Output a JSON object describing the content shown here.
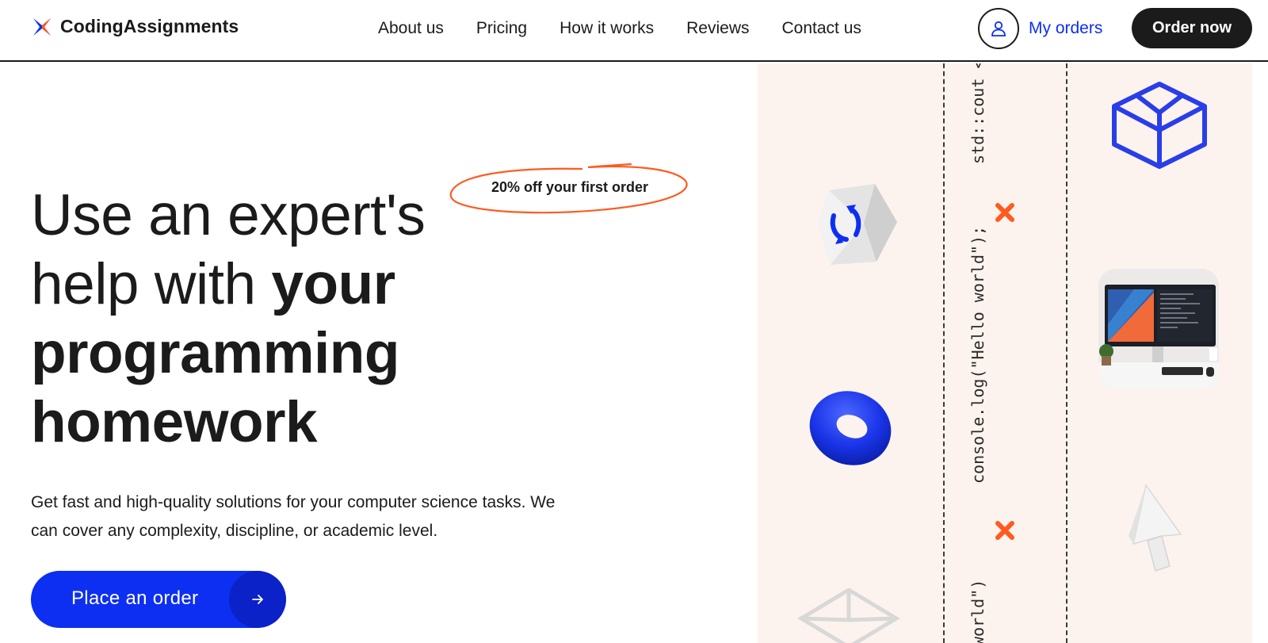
{
  "brand": {
    "name": "CodingAssignments",
    "mark_colors": [
      "#ff5a1f",
      "#0d2ff2"
    ]
  },
  "nav": {
    "items": [
      {
        "label": "About us"
      },
      {
        "label": "Pricing"
      },
      {
        "label": "How it works"
      },
      {
        "label": "Reviews"
      },
      {
        "label": "Contact us"
      }
    ]
  },
  "account": {
    "my_orders_label": "My orders",
    "icon": "user-icon"
  },
  "header_cta": {
    "label": "Order now"
  },
  "hero": {
    "title_line1": "Use an expert's",
    "title_line2_regular": "help with ",
    "title_line2_bold": "your",
    "title_line3": "programming",
    "title_line4": "homework",
    "promo": "20% off your first order",
    "description": "Get fast and high-quality solutions for your computer science tasks. We can cover any complexity, discipline, or academic level.",
    "cta_label": "Place an order",
    "cta_icon": "arrow-right-icon"
  },
  "decor": {
    "code_snippets": [
      "std::cout <<",
      "console.log(\"Hello world\");",
      "world\")"
    ],
    "colors": {
      "panel_bg": "#fcf3ee",
      "accent_blue": "#0d2ff2",
      "accent_orange": "#ff5a1f"
    }
  }
}
